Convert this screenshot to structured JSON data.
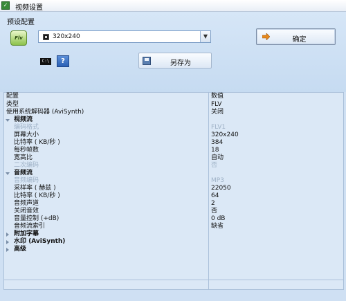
{
  "window": {
    "title": "视频设置"
  },
  "preset": {
    "label": "预设配置",
    "format_icon": "flv-icon",
    "selected": "320x240"
  },
  "buttons": {
    "ok_label": "确定",
    "save_as_label": "另存为",
    "help_label": "?",
    "cmd_label": "C:\\"
  },
  "grid": {
    "header": {
      "name": "配置",
      "value": "数值"
    },
    "rows": [
      {
        "name": "类型",
        "value": "FLV"
      },
      {
        "name": "使用系统解码器 (AviSynth)",
        "value": "关闭"
      },
      {
        "name": "视频流",
        "value": ""
      },
      {
        "name": "编码格式",
        "value": "FLV1"
      },
      {
        "name": "屏幕大小",
        "value": "320x240"
      },
      {
        "name": "比特率 ( KB/秒 )",
        "value": "384"
      },
      {
        "name": "每秒帧数",
        "value": "18"
      },
      {
        "name": "宽高比",
        "value": "自动"
      },
      {
        "name": "二次编码",
        "value": "否"
      },
      {
        "name": "音频流",
        "value": ""
      },
      {
        "name": "音频编码",
        "value": "MP3"
      },
      {
        "name": "采样率 ( 赫兹 )",
        "value": "22050"
      },
      {
        "name": "比特率 ( KB/秒 )",
        "value": "64"
      },
      {
        "name": "音频声道",
        "value": "2"
      },
      {
        "name": "关闭音效",
        "value": "否"
      },
      {
        "name": "音量控制 (+dB)",
        "value": "0 dB"
      },
      {
        "name": "音频流索引",
        "value": "缺省"
      },
      {
        "name": "附加字幕",
        "value": ""
      },
      {
        "name": "水印 (AviSynth)",
        "value": ""
      },
      {
        "name": "高级",
        "value": ""
      }
    ]
  }
}
